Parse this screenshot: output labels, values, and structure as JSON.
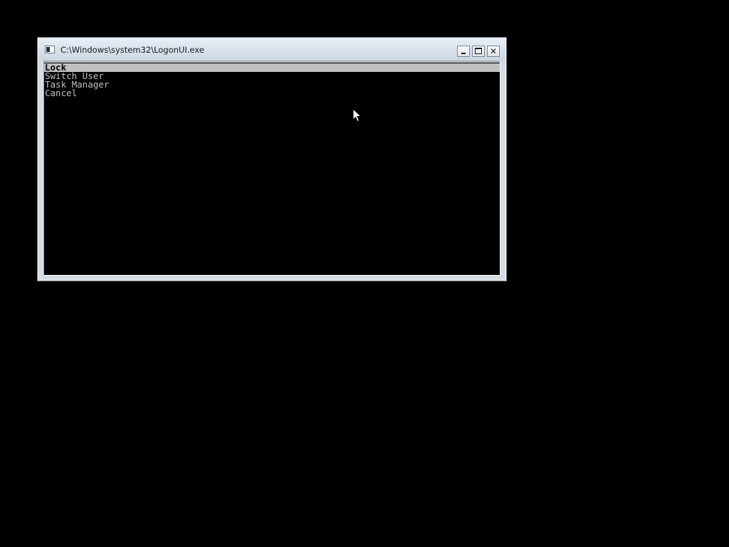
{
  "window": {
    "title": "C:\\Windows\\system32\\LogonUI.exe",
    "icon": "console-icon",
    "controls": {
      "minimize": "minimize-icon",
      "maximize": "maximize-icon",
      "close": "close-icon",
      "close_glyph": "✕"
    }
  },
  "console": {
    "menu_items": [
      {
        "label": "Lock",
        "selected": true
      },
      {
        "label": "Switch User",
        "selected": false
      },
      {
        "label": "Task Manager",
        "selected": false
      },
      {
        "label": "Cancel",
        "selected": false
      }
    ]
  },
  "colors": {
    "desktop_background": "#000000",
    "console_background": "#000000",
    "console_text": "#c0c0c0",
    "selection_background": "#c0c0c0",
    "selection_text": "#000000"
  },
  "cursor": "mouse-pointer-icon"
}
